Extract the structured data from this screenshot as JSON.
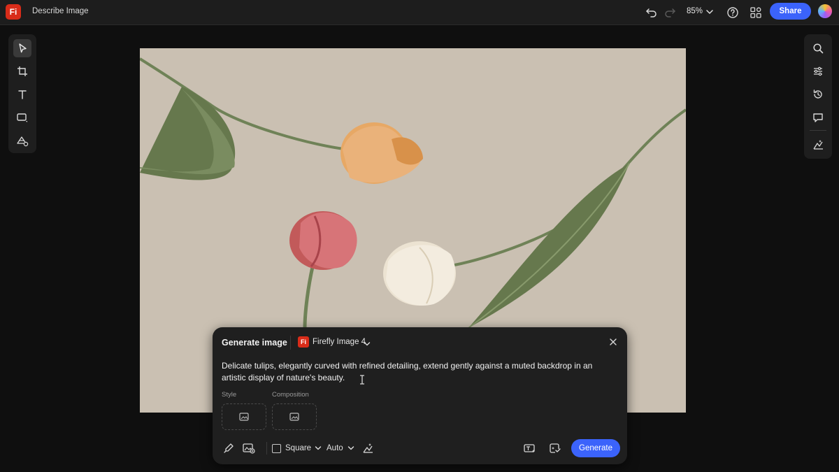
{
  "app": {
    "logo": "Fi",
    "title": "Describe Image"
  },
  "toolbar": {
    "undo_icon": "undo-icon",
    "redo_icon": "redo-icon",
    "zoom": "85%",
    "help_icon": "help-icon",
    "apps_icon": "apps-icon",
    "share_label": "Share",
    "accent": "#3b63fb"
  },
  "left_tools": [
    "select-tool",
    "crop-tool",
    "text-tool",
    "shape-tool",
    "generate-tool"
  ],
  "right_tools": [
    "search",
    "adjustments",
    "history",
    "comments",
    "generative-settings"
  ],
  "canvas": {
    "background": "#cac0b2"
  },
  "panel": {
    "title": "Generate image",
    "model_logo": "Fi",
    "model": "Firefly Image 4",
    "prompt": "Delicate tulips, elegantly curved with refined detailing, extend gently against a muted backdrop in an artistic display of nature's beauty.",
    "style_label": "Style",
    "composition_label": "Composition",
    "aspect": "Square",
    "content_type": "Auto",
    "generate_label": "Generate"
  }
}
